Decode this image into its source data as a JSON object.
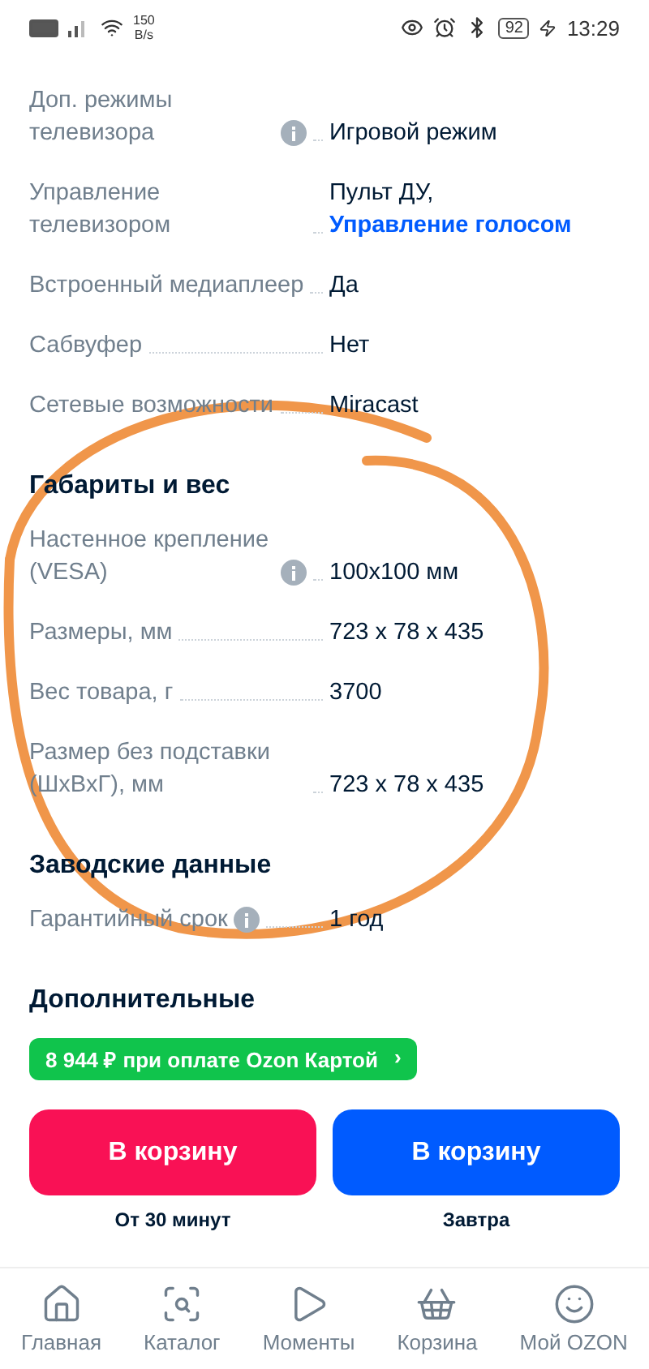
{
  "status_bar": {
    "speed": "150",
    "speed_unit": "B/s",
    "battery": "92",
    "time": "13:29"
  },
  "sections": [
    {
      "rows": [
        {
          "label": "Доп. режимы телевизора",
          "info": true,
          "value": "Игровой режим"
        },
        {
          "label": "Управление телевизором",
          "info": false,
          "value": "Пульт ДУ,",
          "link": "Управление голосом"
        },
        {
          "label": "Встроенный медиаплеер",
          "info": false,
          "value": "Да"
        },
        {
          "label": "Сабвуфер",
          "info": false,
          "value": "Нет"
        },
        {
          "label": "Сетевые возможности",
          "info": false,
          "value": "Miracast"
        }
      ]
    },
    {
      "title": "Габариты и вес",
      "rows": [
        {
          "label": "Настенное крепление (VESA)",
          "info": true,
          "value": "100x100 мм"
        },
        {
          "label": "Размеры, мм",
          "info": false,
          "value": "723 x 78 x 435"
        },
        {
          "label": "Вес товара, г",
          "info": false,
          "value": "3700"
        },
        {
          "label": "Размер без подставки (ШxВxГ), мм",
          "info": false,
          "value": "723 x 78 x 435"
        }
      ]
    },
    {
      "title": "Заводские данные",
      "rows": [
        {
          "label": "Гарантийный срок",
          "info": true,
          "value": "1 год"
        }
      ]
    },
    {
      "title": "Дополнительные"
    }
  ],
  "promo": {
    "text": "8 944 ₽ при оплате Ozon Картой",
    "chevron": "›"
  },
  "buttons": [
    {
      "label": "В корзину",
      "caption": "От 30 минут",
      "kind": "express"
    },
    {
      "label": "В корзину",
      "caption": "Завтра",
      "kind": "standard"
    }
  ],
  "nav": [
    {
      "label": "Главная",
      "selected": false
    },
    {
      "label": "Каталог",
      "selected": false
    },
    {
      "label": "Моменты",
      "selected": false
    },
    {
      "label": "Корзина",
      "selected": false
    },
    {
      "label": "Мой OZON",
      "selected": false
    }
  ]
}
